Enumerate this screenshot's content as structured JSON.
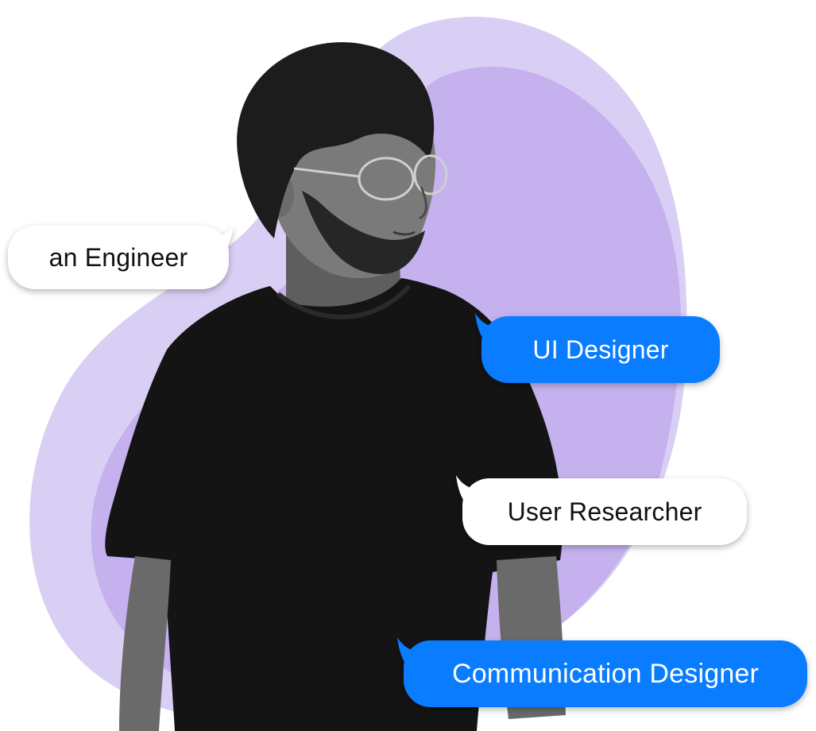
{
  "bubbles": {
    "engineer": "an Engineer",
    "ui_designer": "UI Designer",
    "user_researcher": "User Researcher",
    "communication_designer": "Communication Designer"
  },
  "colors": {
    "blob_light": "#d9cff4",
    "blob_dark": "#c4b1ee",
    "bubble_blue": "#0a7cff",
    "bubble_white": "#ffffff",
    "shirt": "#141414",
    "skin": "#6e6e6e",
    "hair": "#1c1c1c"
  }
}
